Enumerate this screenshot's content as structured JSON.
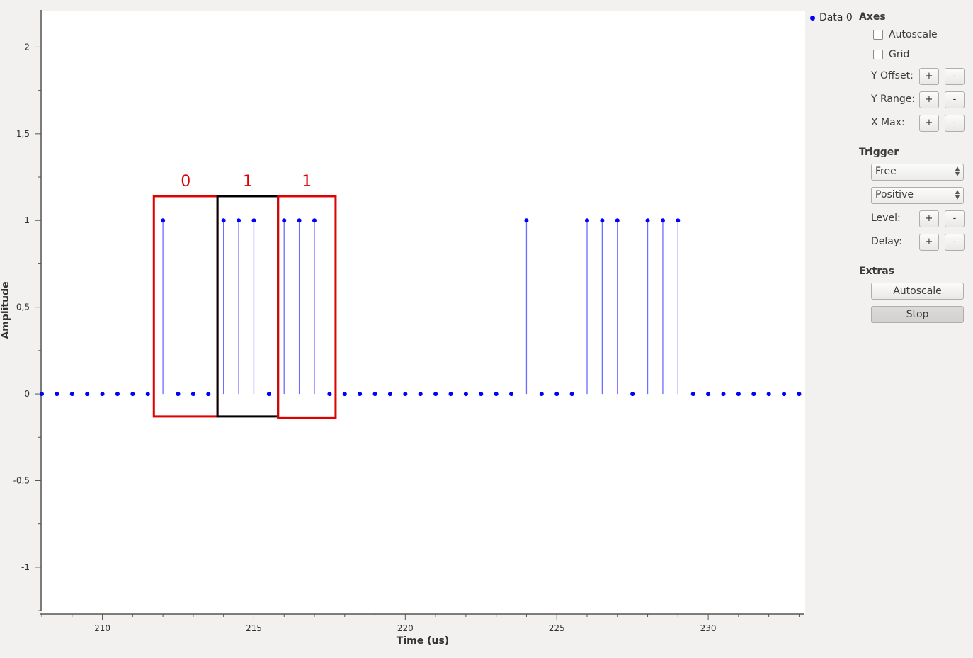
{
  "plot": {
    "xlabel": "Time (us)",
    "ylabel": "Amplitude",
    "x_ticks": [
      "210",
      "215",
      "220",
      "225",
      "230"
    ],
    "y_ticks": [
      "2",
      "1,5",
      "1",
      "0,5",
      "0",
      "-0,5",
      "-1"
    ]
  },
  "legend": {
    "label": "Data 0",
    "color": "#0000ff"
  },
  "annotations": {
    "labels": [
      "0",
      "1",
      "1"
    ],
    "box_colors": [
      "#e00000",
      "#000000",
      "#e00000"
    ]
  },
  "chart_data": {
    "type": "stem",
    "xlabel": "Time (us)",
    "ylabel": "Amplitude",
    "xlim": [
      208,
      233.2
    ],
    "ylim": [
      -1.27,
      2.21
    ],
    "series": [
      {
        "name": "Data 0",
        "color": "#0000ff",
        "x": [
          208,
          208.5,
          209,
          209.5,
          210,
          210.5,
          211,
          211.5,
          212,
          212.5,
          213,
          213.5,
          214,
          214.5,
          215,
          215.5,
          216,
          216.5,
          217,
          217.5,
          218,
          218.5,
          219,
          219.5,
          220,
          220.5,
          221,
          221.5,
          222,
          222.5,
          223,
          223.5,
          224,
          224.5,
          225,
          225.5,
          226,
          226.5,
          227,
          227.5,
          228,
          228.5,
          229,
          229.5,
          230,
          230.5,
          231,
          231.5,
          232,
          232.5,
          233
        ],
        "values": [
          0,
          0,
          0,
          0,
          0,
          0,
          0,
          0,
          1,
          0,
          0,
          0,
          1,
          1,
          1,
          0,
          1,
          1,
          1,
          0,
          0,
          0,
          0,
          0,
          0,
          0,
          0,
          0,
          0,
          0,
          0,
          0,
          1,
          0,
          0,
          0,
          1,
          1,
          1,
          0,
          1,
          1,
          1,
          0,
          0,
          0,
          0,
          0,
          0,
          0,
          0
        ]
      }
    ]
  },
  "panel": {
    "axes_title": "Axes",
    "autoscale_label": "Autoscale",
    "grid_label": "Grid",
    "y_offset_label": "Y Offset:",
    "y_range_label": "Y Range:",
    "x_max_label": "X Max:",
    "plus": "+",
    "minus": "-",
    "trigger_title": "Trigger",
    "trigger_mode": "Free",
    "trigger_slope": "Positive",
    "level_label": "Level:",
    "delay_label": "Delay:",
    "extras_title": "Extras",
    "autoscale_button": "Autoscale",
    "stop_button": "Stop"
  }
}
